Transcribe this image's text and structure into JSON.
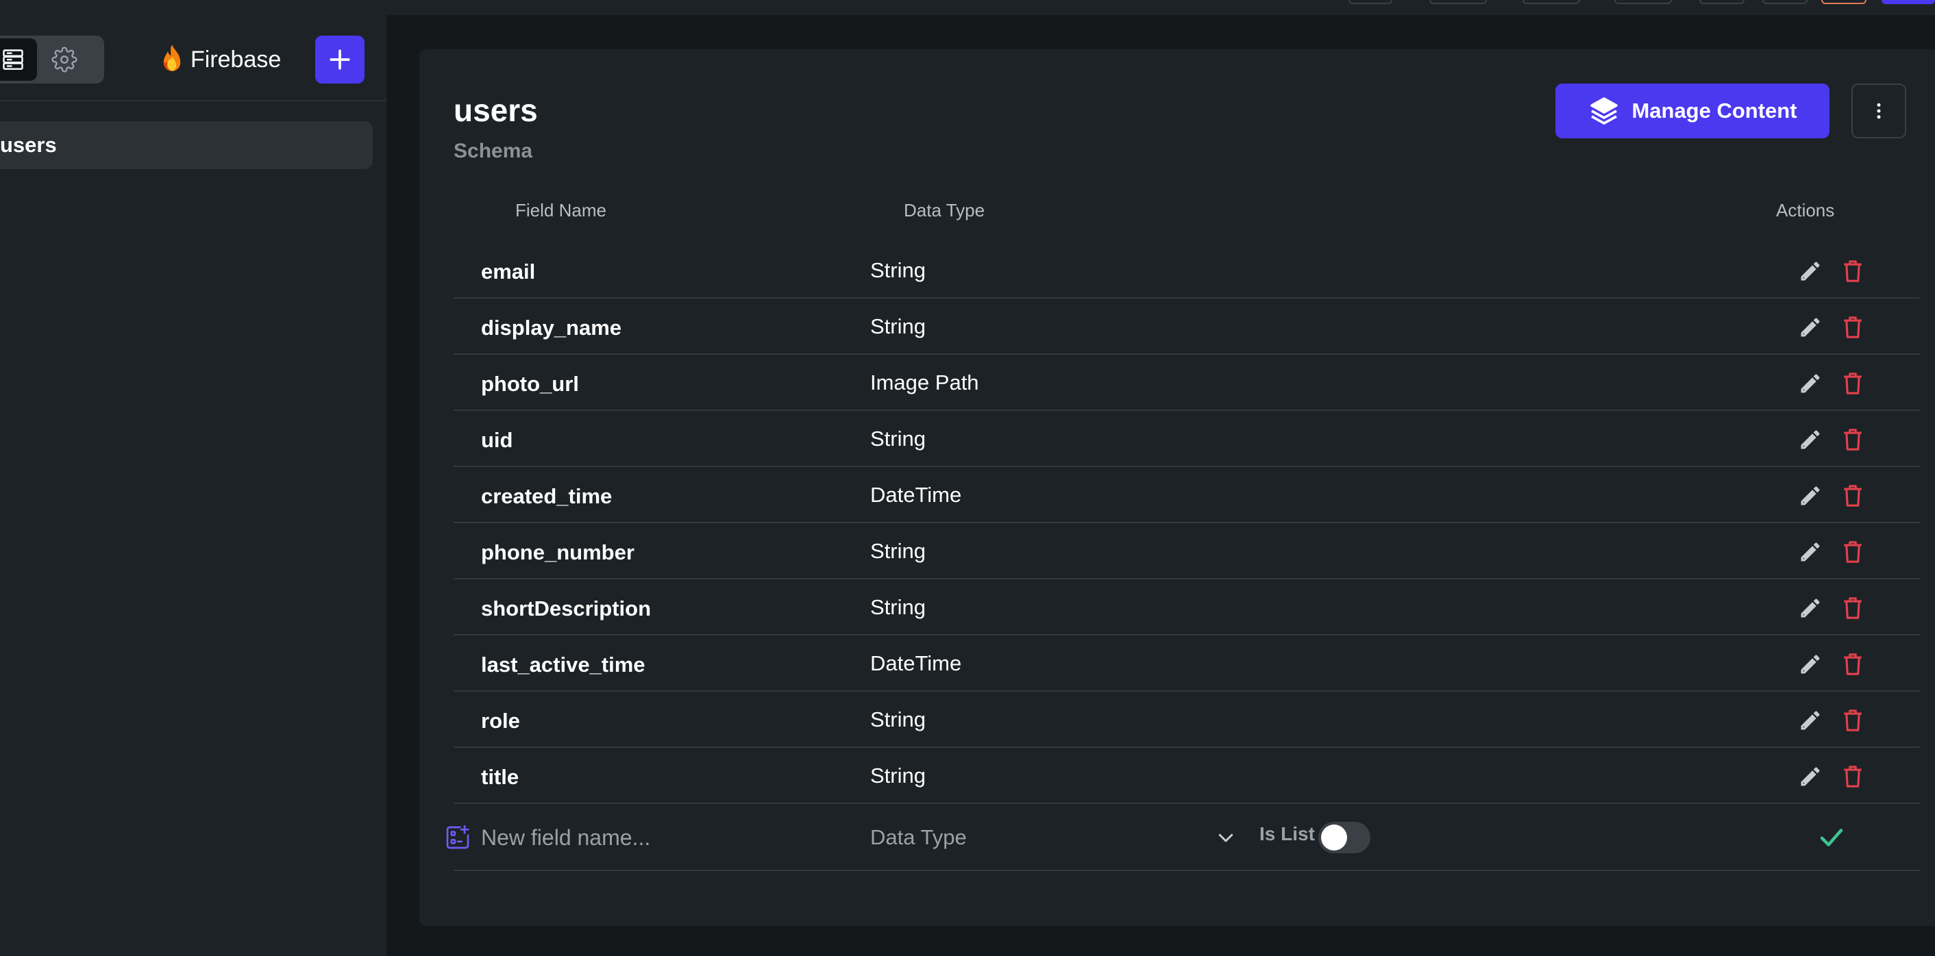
{
  "colors": {
    "accent": "#4b39ef",
    "danger": "#e2404d",
    "success": "#3fc38f",
    "background": "#14181b",
    "panel": "#1d2226"
  },
  "sidebar": {
    "view_icons": [
      "database-icon",
      "gear-icon"
    ],
    "brand_label": "Firebase",
    "collections": [
      {
        "label": "users",
        "selected": true
      }
    ]
  },
  "main": {
    "title": "users",
    "subtitle": "Schema",
    "manage_button_label": "Manage Content",
    "table": {
      "headers": {
        "field_name": "Field Name",
        "data_type": "Data Type",
        "actions": "Actions"
      },
      "rows": [
        {
          "name": "email",
          "type": "String"
        },
        {
          "name": "display_name",
          "type": "String"
        },
        {
          "name": "photo_url",
          "type": "Image Path"
        },
        {
          "name": "uid",
          "type": "String"
        },
        {
          "name": "created_time",
          "type": "DateTime"
        },
        {
          "name": "phone_number",
          "type": "String"
        },
        {
          "name": "shortDescription",
          "type": "String"
        },
        {
          "name": "last_active_time",
          "type": "DateTime"
        },
        {
          "name": "role",
          "type": "String"
        },
        {
          "name": "title",
          "type": "String"
        }
      ],
      "new_field": {
        "name_placeholder": "New field name...",
        "data_type_placeholder": "Data Type",
        "is_list_label": "Is List",
        "is_list": false
      }
    }
  }
}
